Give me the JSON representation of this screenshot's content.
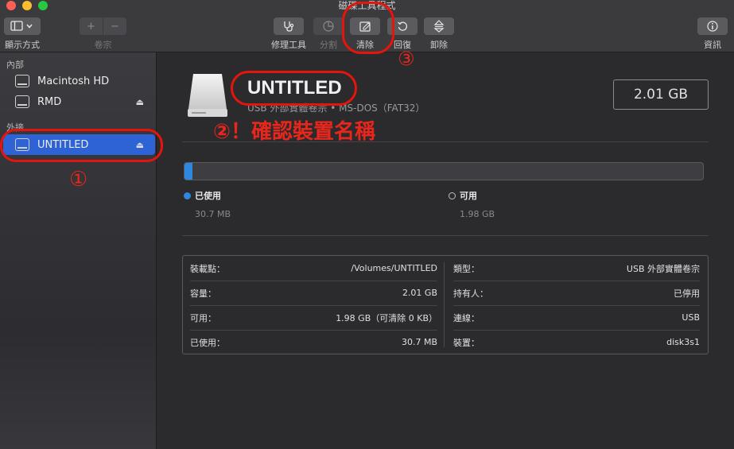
{
  "window": {
    "title": "磁碟工具程式"
  },
  "toolbar": {
    "view_label": "顯示方式",
    "volume_label": "卷宗",
    "first_aid_label": "修理工具",
    "partition_label": "分割",
    "erase_label": "清除",
    "restore_label": "回復",
    "unmount_label": "卸除",
    "info_label": "資訊",
    "plus": "+",
    "minus": "−"
  },
  "sidebar": {
    "internal_header": "內部",
    "external_header": "外接",
    "items": [
      {
        "label": "Macintosh HD"
      },
      {
        "label": "RMD"
      },
      {
        "label": "UNTITLED"
      }
    ]
  },
  "volume": {
    "name": "UNTITLED",
    "subtitle": "USB 外部實體卷宗 • MS-DOS（FAT32）",
    "capacity": "2.01 GB",
    "used_fraction": 0.015
  },
  "usage": {
    "used_label": "已使用",
    "used_value": "30.7 MB",
    "free_label": "可用",
    "free_value": "1.98 GB"
  },
  "info": {
    "left": [
      {
        "key": "裝載點：",
        "value": "/Volumes/UNTITLED"
      },
      {
        "key": "容量：",
        "value": "2.01 GB"
      },
      {
        "key": "可用：",
        "value": "1.98 GB（可清除 0 KB）"
      },
      {
        "key": "已使用：",
        "value": "30.7 MB"
      }
    ],
    "right": [
      {
        "key": "類型：",
        "value": "USB 外部實體卷宗"
      },
      {
        "key": "持有人：",
        "value": "已停用"
      },
      {
        "key": "連線：",
        "value": "USB"
      },
      {
        "key": "裝置：",
        "value": "disk3s1"
      }
    ]
  },
  "annotations": {
    "step1": "①",
    "step2": "②！確認裝置名稱",
    "step3": "③"
  },
  "colors": {
    "accent": "#2d63d4",
    "annotation": "#e3150d",
    "used": "#2e88e0"
  }
}
